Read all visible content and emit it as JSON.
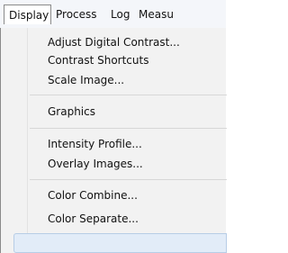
{
  "menubar": {
    "items": [
      "Display",
      "Process",
      "Log",
      "Measu"
    ]
  },
  "dropdown": {
    "items": [
      "Adjust Digital Contrast...",
      "Contrast Shortcuts",
      "Scale Image...",
      "Graphics",
      "Intensity Profile...",
      "Overlay Images...",
      "Color Combine...",
      "Color Separate..."
    ]
  }
}
